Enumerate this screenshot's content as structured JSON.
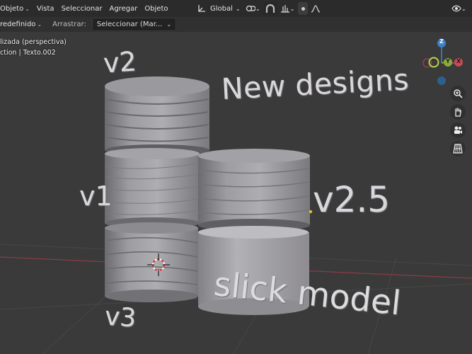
{
  "header": {
    "menus": [
      {
        "label": "Objeto",
        "caret": true
      },
      {
        "label": "Vista",
        "caret": false
      },
      {
        "label": "Seleccionar",
        "caret": false
      },
      {
        "label": "Agregar",
        "caret": false
      },
      {
        "label": "Objeto",
        "caret": false
      }
    ],
    "orientation_label": "Global"
  },
  "toolbar": {
    "preset_label": "redefinido",
    "drag_label": "Arrastrar:",
    "drag_value": "Seleccionar (Mar..."
  },
  "viewport": {
    "view_name": "lizada (perspectiva)",
    "collection_info": "ction | Texto.002",
    "gizmo": {
      "z": "Z",
      "x": "X",
      "y": "Y"
    },
    "scene_texts": {
      "title": "New designs",
      "v2": "v2",
      "v1": "v1",
      "v25": "v2.5",
      "v3": "v3",
      "slick": "slick model"
    }
  },
  "colors": {
    "header_bg": "#2b2b2b",
    "viewport_bg": "#3a3a3a",
    "axis_red": "#c94a55",
    "axis_green": "#8aab3a",
    "axis_blue": "#3b82c9"
  }
}
